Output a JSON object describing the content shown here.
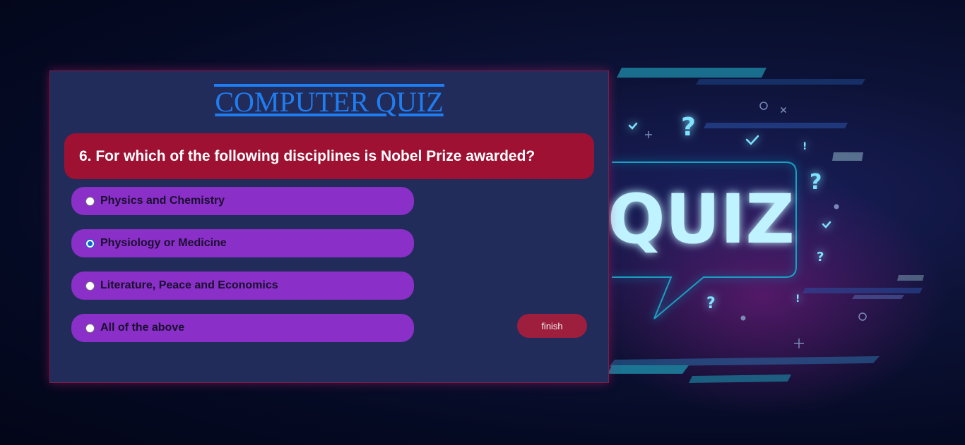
{
  "quiz": {
    "title": "COMPUTER QUIZ",
    "question": "6. For which of the following disciplines is Nobel Prize awarded?",
    "options": [
      {
        "label": "Physics and Chemistry",
        "selected": false
      },
      {
        "label": "Physiology or Medicine",
        "selected": true
      },
      {
        "label": "Literature, Peace and Economics",
        "selected": false
      },
      {
        "label": "All of the above",
        "selected": false
      }
    ],
    "finish_label": "finish"
  },
  "background": {
    "banner_text": "QUIZ",
    "marks": [
      "?",
      "?",
      "?",
      "?",
      "?",
      "!",
      "!"
    ]
  },
  "colors": {
    "title": "#1f7df2",
    "question_bg": "#9e1133",
    "option_bg": "#8a2fc7",
    "panel_bg": "#222c5a",
    "finish_bg": "#9e1e3d",
    "neon": "#7fe2ff"
  }
}
